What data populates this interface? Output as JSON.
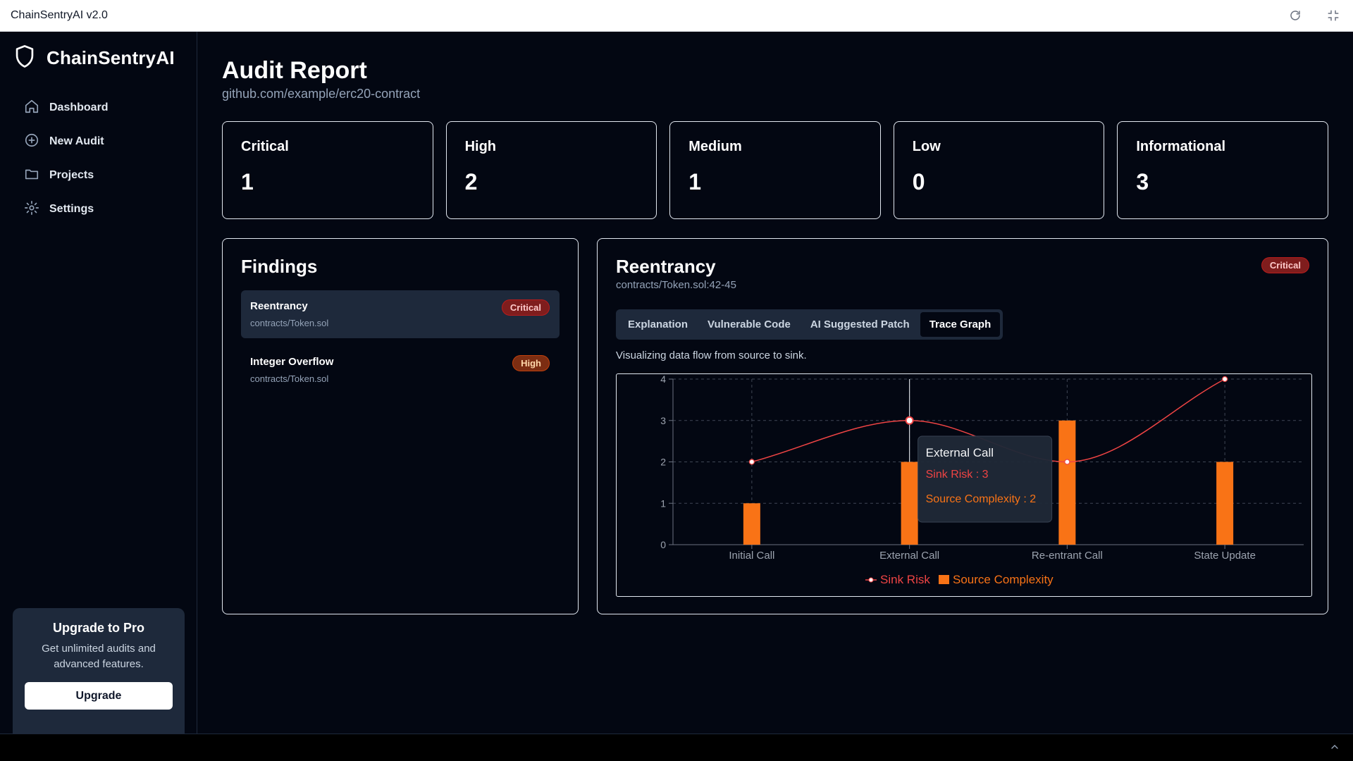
{
  "window": {
    "title": "ChainSentryAI v2.0",
    "refresh_icon": "refresh-icon",
    "fullscreen_icon": "fullscreen-icon"
  },
  "sidebar": {
    "brand": "ChainSentryAI",
    "logo_icon": "shield-icon",
    "items": [
      {
        "label": "Dashboard",
        "icon": "home-icon"
      },
      {
        "label": "New Audit",
        "icon": "plus-circle-icon"
      },
      {
        "label": "Projects",
        "icon": "folder-icon"
      },
      {
        "label": "Settings",
        "icon": "gear-icon"
      }
    ],
    "upgrade": {
      "title": "Upgrade to Pro",
      "description": "Get unlimited audits and advanced features.",
      "button": "Upgrade"
    }
  },
  "header": {
    "title": "Audit Report",
    "repo": "github.com/example/erc20-contract"
  },
  "stats": [
    {
      "label": "Critical",
      "value": "1"
    },
    {
      "label": "High",
      "value": "2"
    },
    {
      "label": "Medium",
      "value": "1"
    },
    {
      "label": "Low",
      "value": "0"
    },
    {
      "label": "Informational",
      "value": "3"
    }
  ],
  "findings": {
    "title": "Findings",
    "items": [
      {
        "title": "Reentrancy",
        "file": "contracts/Token.sol",
        "severity": "Critical",
        "active": true
      },
      {
        "title": "Integer Overflow",
        "file": "contracts/Token.sol",
        "severity": "High",
        "active": false
      }
    ]
  },
  "detail": {
    "title": "Reentrancy",
    "location": "contracts/Token.sol:42-45",
    "severity": "Critical",
    "tabs": [
      "Explanation",
      "Vulnerable Code",
      "AI Suggested Patch",
      "Trace Graph"
    ],
    "active_tab": "Trace Graph",
    "caption": "Visualizing data flow from source to sink."
  },
  "colors": {
    "sink": "#ef4444",
    "source": "#f97316",
    "critical_bg": "#7f1d1d",
    "high_bg": "#7c2d12"
  },
  "chart_data": {
    "type": "bar",
    "categories": [
      "Initial Call",
      "External Call",
      "Re-entrant Call",
      "State Update"
    ],
    "series": [
      {
        "name": "Sink Risk",
        "kind": "line",
        "color": "#ef4444",
        "values": [
          2,
          3,
          2,
          4
        ]
      },
      {
        "name": "Source Complexity",
        "kind": "bar",
        "color": "#f97316",
        "values": [
          1,
          2,
          3,
          2
        ]
      }
    ],
    "ylim": [
      0,
      4
    ],
    "yticks": [
      0,
      1,
      2,
      3,
      4
    ],
    "grid": true,
    "legend": "bottom",
    "tooltip": {
      "category": "External Call",
      "lines": [
        "Sink Risk : 3",
        "Source Complexity : 2"
      ]
    }
  },
  "bottombar": {
    "icon": "chevron-up-icon"
  }
}
